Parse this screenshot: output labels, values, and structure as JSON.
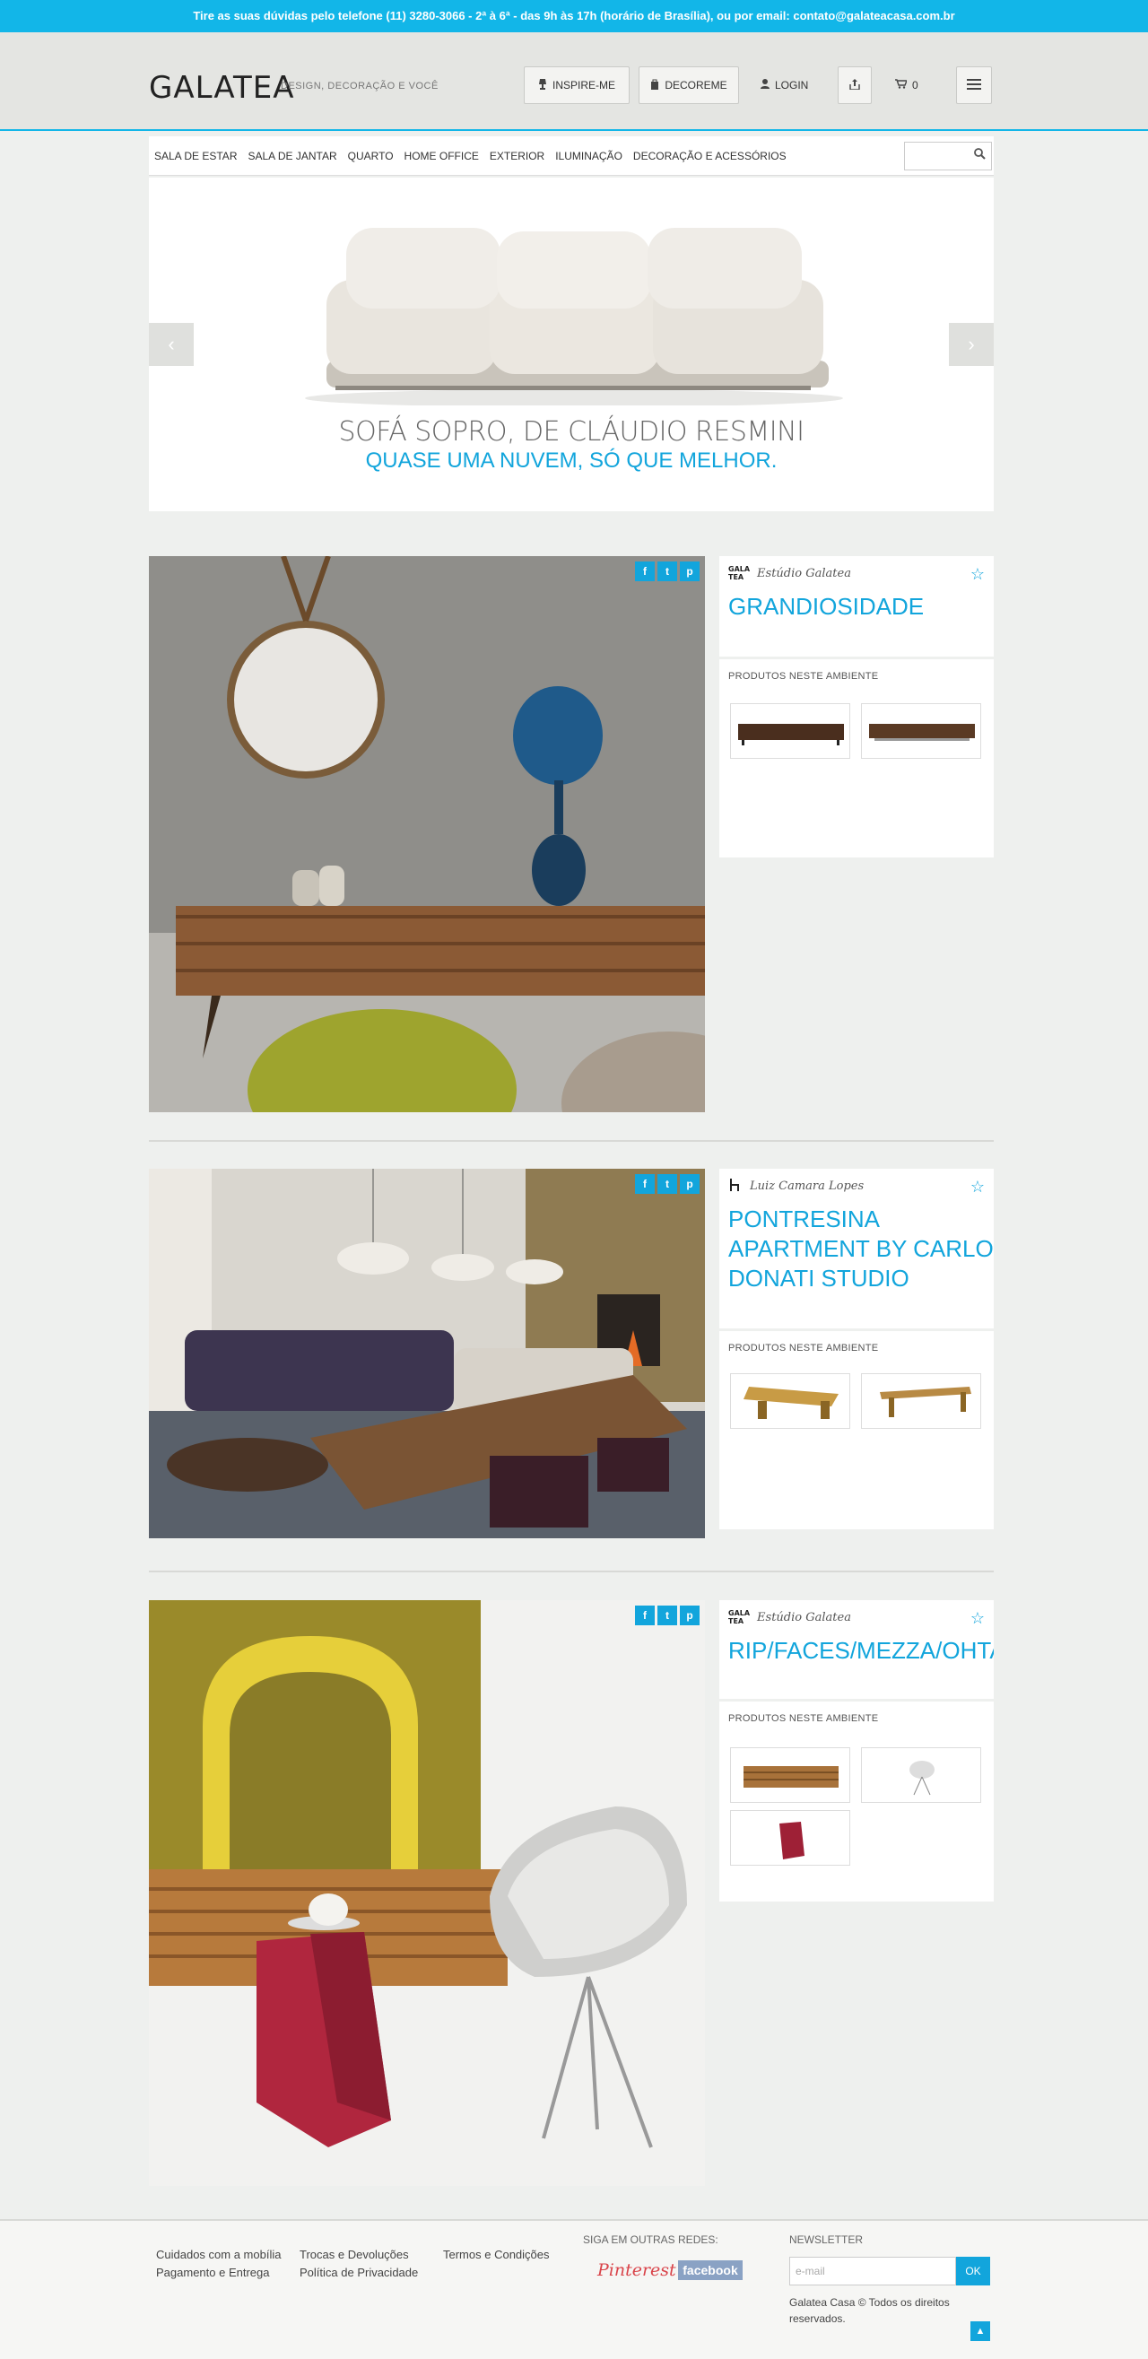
{
  "topbar": {
    "text": "Tire as suas dúvidas pelo telefone (11) 3280-3066 - 2ª à 6ª - das 9h às 17h (horário de Brasília), ou por email: contato@galateacasa.com.br"
  },
  "header": {
    "logo": "GALATEA",
    "tagline": "DESIGN, DECORAÇÃO E VOCÊ",
    "inspire_label": "INSPIRE-ME",
    "decoreme_label": "DECOREME",
    "login_label": "LOGIN",
    "cart_count": "0"
  },
  "nav": {
    "items": [
      "SALA DE ESTAR",
      "SALA DE JANTAR",
      "QUARTO",
      "HOME OFFICE",
      "EXTERIOR",
      "ILUMINAÇÃO",
      "DECORAÇÃO E ACESSÓRIOS"
    ],
    "search_placeholder": ""
  },
  "hero": {
    "title": "SOFÁ SOPRO, DE CLÁUDIO RESMINI",
    "subtitle": "QUASE UMA NUVEM, SÓ QUE MELHOR.",
    "prev": "‹",
    "next": "›"
  },
  "social": {
    "facebook": "f",
    "twitter": "t",
    "pinterest": "p"
  },
  "ambientes": [
    {
      "studio": "Estúdio Galatea",
      "studio_logo": "GALA\nTEA",
      "title": "GRANDIOSIDADE",
      "products_label": "PRODUTOS NESTE AMBIENTE"
    },
    {
      "studio": "Luiz Camara Lopes",
      "title_lines": [
        "PONTRESINA",
        "APARTMENT BY CARLO",
        "DONATI STUDIO"
      ],
      "products_label": "PRODUTOS NESTE AMBIENTE"
    },
    {
      "studio": "Estúdio Galatea",
      "studio_logo": "GALA\nTEA",
      "title": "RIP/FACES/MEZZA/OHTAKE",
      "products_label": "PRODUTOS NESTE AMBIENTE"
    }
  ],
  "footer": {
    "links_col1": [
      "Cuidados com a mobília",
      "Pagamento e Entrega"
    ],
    "links_col2": [
      "Trocas e Devoluções",
      "Política de Privacidade"
    ],
    "links_col3": [
      "Termos e Condições"
    ],
    "social_heading": "SIGA EM OUTRAS REDES:",
    "pinterest": "Pinterest",
    "facebook": "facebook",
    "newsletter_heading": "NEWSLETTER",
    "newsletter_placeholder": "e-mail",
    "newsletter_button": "OK",
    "copyright_line1": "Galatea Casa © Todos os direitos",
    "copyright_line2": "reservados."
  },
  "colors": {
    "accent": "#12a5dc",
    "topbar": "#12b6e8",
    "background": "#eef0ee"
  }
}
